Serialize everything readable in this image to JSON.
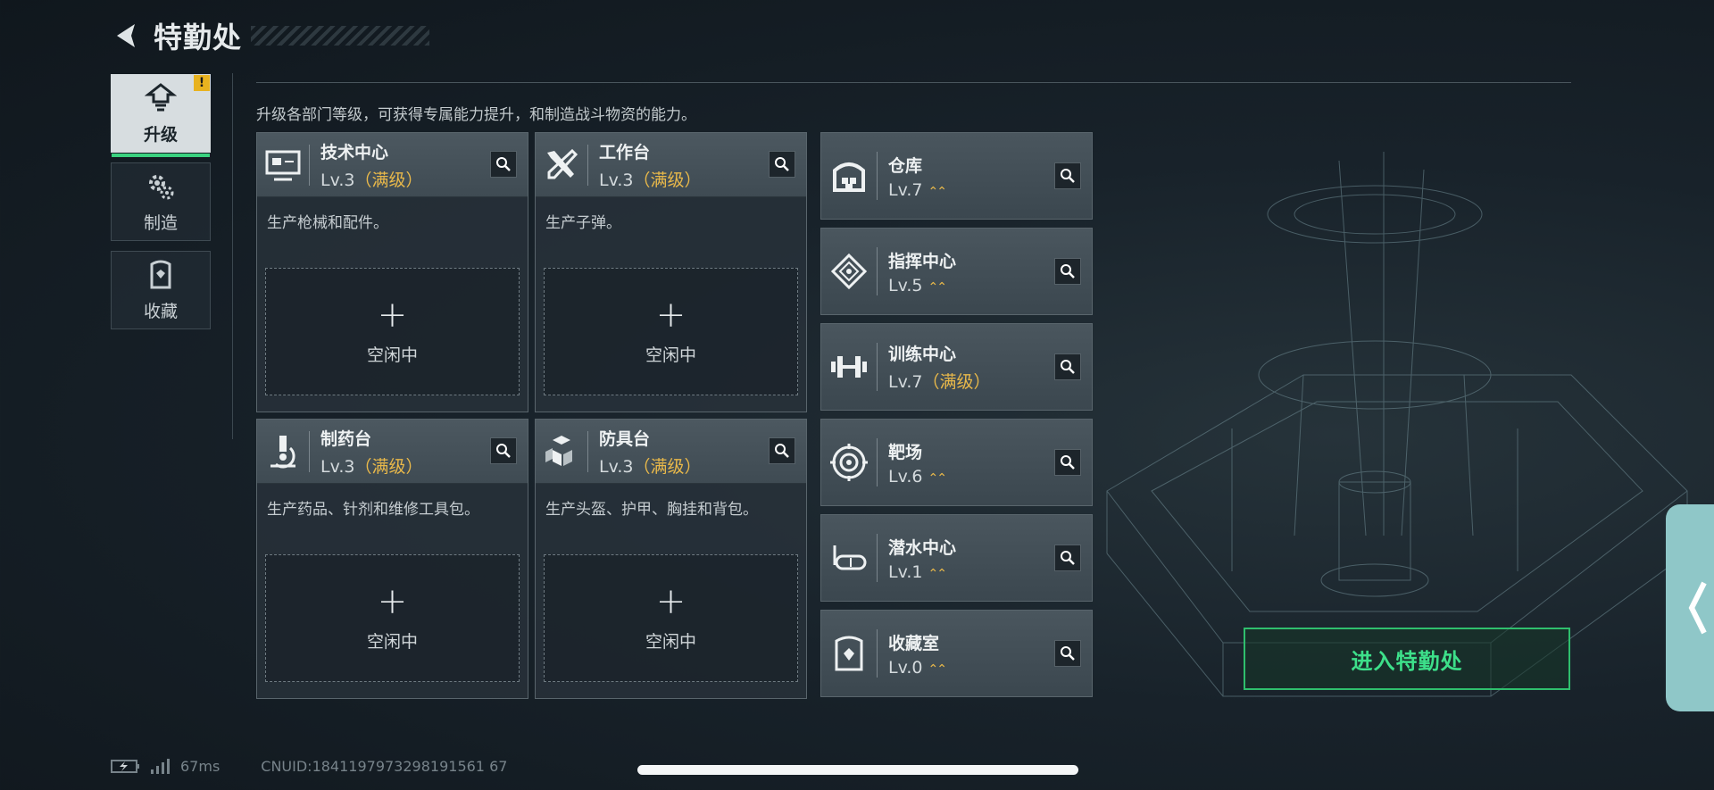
{
  "header": {
    "title": "特勤处"
  },
  "nav": {
    "items": [
      {
        "label": "升级",
        "icon": "upgrade-icon",
        "active": true,
        "alert": "!"
      },
      {
        "label": "制造",
        "icon": "gears-icon",
        "active": false
      },
      {
        "label": "收藏",
        "icon": "collection-icon",
        "active": false
      }
    ]
  },
  "description": "升级各部门等级，可获得专属能力提升，和制造战斗物资的能力。",
  "workstations": [
    {
      "name": "技术中心",
      "level": "Lv.3",
      "max": "（满级）",
      "desc": "生产枪械和配件。",
      "slot_plus": "+",
      "slot_status": "空闲中",
      "icon": "monitor-icon"
    },
    {
      "name": "工作台",
      "level": "Lv.3",
      "max": "（满级）",
      "desc": "生产子弹。",
      "slot_plus": "+",
      "slot_status": "空闲中",
      "icon": "tools-icon"
    },
    {
      "name": "制药台",
      "level": "Lv.3",
      "max": "（满级）",
      "desc": "生产药品、针剂和维修工具包。",
      "slot_plus": "+",
      "slot_status": "空闲中",
      "icon": "microscope-icon"
    },
    {
      "name": "防具台",
      "level": "Lv.3",
      "max": "（满级）",
      "desc": "生产头盔、护甲、胸挂和背包。",
      "slot_plus": "+",
      "slot_status": "空闲中",
      "icon": "armor-boxes-icon"
    }
  ],
  "facilities": [
    {
      "name": "仓库",
      "level": "Lv.7",
      "max": "",
      "upgradable": true,
      "icon": "warehouse-icon"
    },
    {
      "name": "指挥中心",
      "level": "Lv.5",
      "max": "",
      "upgradable": true,
      "icon": "command-icon"
    },
    {
      "name": "训练中心",
      "level": "Lv.7",
      "max": "（满级）",
      "upgradable": false,
      "icon": "dumbbell-icon"
    },
    {
      "name": "靶场",
      "level": "Lv.6",
      "max": "",
      "upgradable": true,
      "icon": "target-icon"
    },
    {
      "name": "潜水中心",
      "level": "Lv.1",
      "max": "",
      "upgradable": true,
      "icon": "diving-mask-icon"
    },
    {
      "name": "收藏室",
      "level": "Lv.0",
      "max": "",
      "upgradable": true,
      "icon": "collection-room-icon"
    }
  ],
  "upgrade_arrow": "⌃⌃",
  "enter_button": {
    "label": "进入特勤处"
  },
  "footer": {
    "ping": "67ms",
    "uid": "CN UID:18411979732981915б167"
  },
  "colors": {
    "accent": "#3ad27f",
    "max_level": "#e8b84a",
    "alert": "#e8b21f"
  }
}
